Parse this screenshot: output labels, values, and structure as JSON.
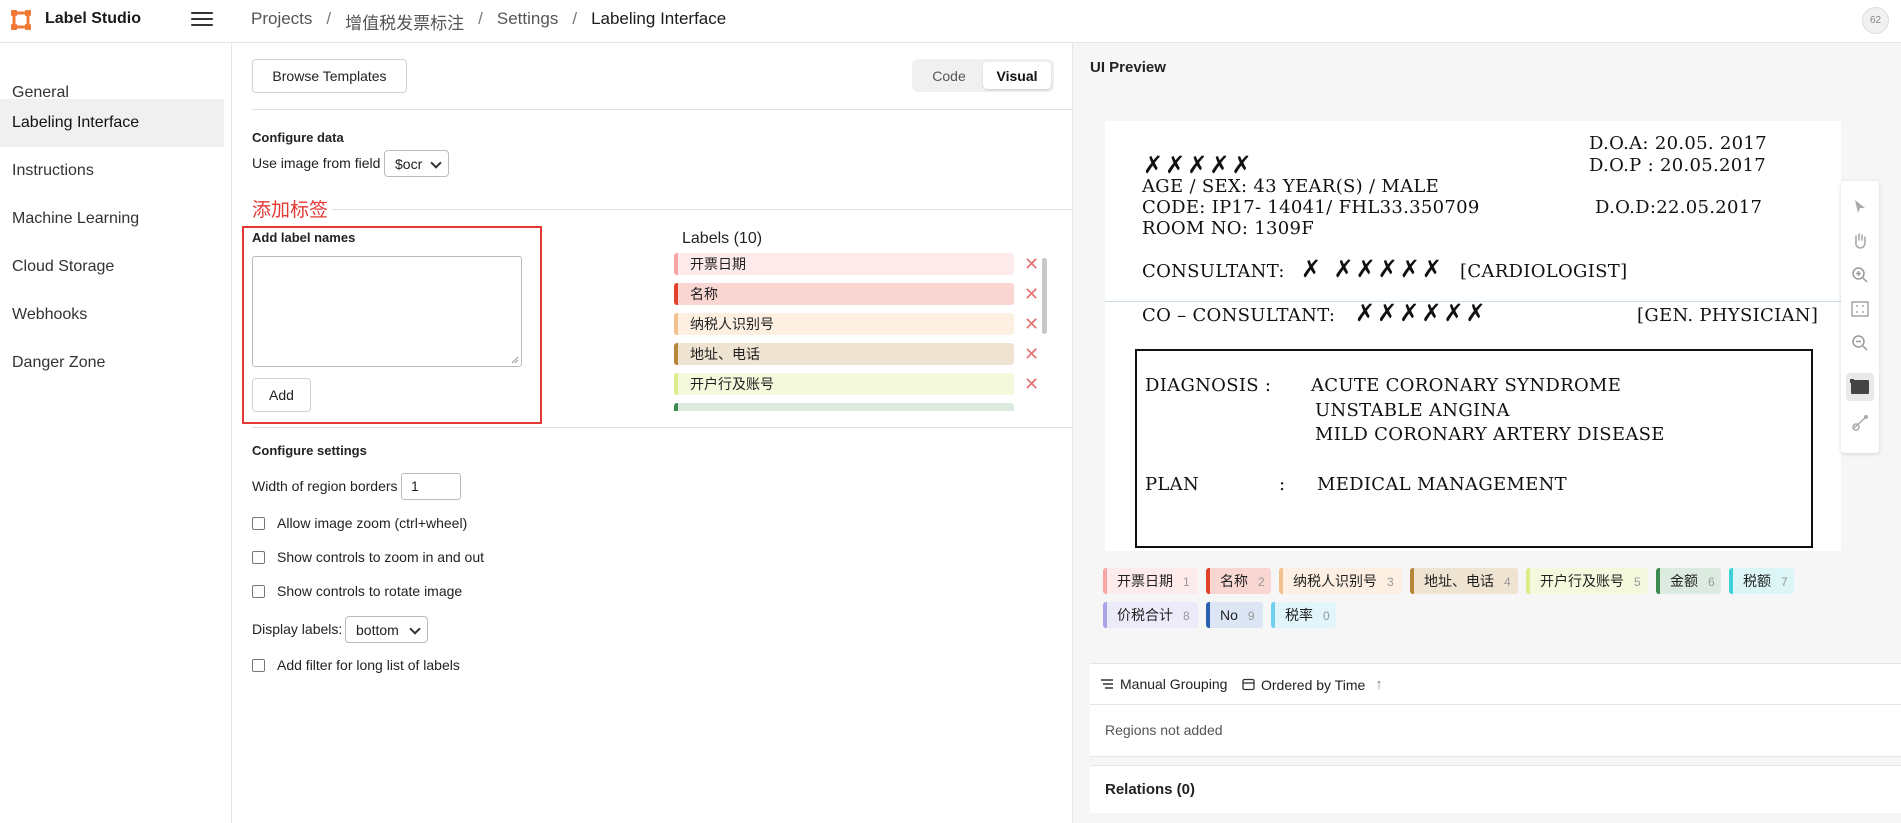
{
  "app": {
    "title": "Label Studio"
  },
  "breadcrumb": [
    "Projects",
    "增值税发票标注",
    "Settings",
    "Labeling Interface"
  ],
  "avatar": "62",
  "sidebar": {
    "items": [
      {
        "label": "General",
        "active": false
      },
      {
        "label": "Labeling Interface",
        "active": true
      },
      {
        "label": "Instructions",
        "active": false
      },
      {
        "label": "Machine Learning",
        "active": false
      },
      {
        "label": "Cloud Storage",
        "active": false
      },
      {
        "label": "Webhooks",
        "active": false
      },
      {
        "label": "Danger Zone",
        "active": false
      }
    ]
  },
  "config": {
    "browse_templates": "Browse Templates",
    "view_toggle": {
      "code": "Code",
      "visual": "Visual",
      "selected": "Visual"
    },
    "configure_data": {
      "title": "Configure data",
      "field_label": "Use image from field",
      "field_value": "$ocr"
    },
    "annotation_note": "添加标签",
    "add_labels": {
      "title": "Add label names",
      "textarea_value": "",
      "add_button": "Add"
    },
    "labels": {
      "title": "Labels (10)",
      "items": [
        {
          "name": "开票日期",
          "color": "#f8a5a5",
          "bg": "#fdeaea"
        },
        {
          "name": "名称",
          "color": "#e0422b",
          "bg": "#f9d6d1"
        },
        {
          "name": "纳税人识别号",
          "color": "#f2c08f",
          "bg": "#fdf0e3"
        },
        {
          "name": "地址、电话",
          "color": "#b8863b",
          "bg": "#efe4d2"
        },
        {
          "name": "开户行及账号",
          "color": "#dcec8a",
          "bg": "#f4f9de"
        }
      ]
    },
    "configure_settings": {
      "title": "Configure settings",
      "region_border_label": "Width of region borders",
      "region_border_value": "1",
      "checkbox_zoom": "Allow image zoom (ctrl+wheel)",
      "checkbox_zoom_controls": "Show controls to zoom in and out",
      "checkbox_rotate": "Show controls to rotate image",
      "display_labels_label": "Display labels:",
      "display_labels_value": "bottom",
      "checkbox_filter": "Add filter for long list of labels"
    }
  },
  "preview": {
    "title": "UI Preview",
    "document": {
      "doa": "D.O.A: 20.05. 2017",
      "dop": "D.O.P : 20.05.2017",
      "dod": "D.O.D:22.05.2017",
      "age_sex": "AGE / SEX: 43 YEAR(S) / MALE",
      "code": "CODE: IP17- 14041/ FHL33.350709",
      "room": "ROOM NO: 1309F",
      "consultant_label": "CONSULTANT:",
      "consultant_role": "[CARDIOLOGIST]",
      "co_consultant_label": "CO – CONSULTANT:",
      "co_consultant_role": "[GEN. PHYSICIAN]",
      "diagnosis_label": "DIAGNOSIS :",
      "diagnosis_1": "ACUTE CORONARY SYNDROME",
      "diagnosis_2": "UNSTABLE ANGINA",
      "diagnosis_3": "MILD CORONARY ARTERY DISEASE",
      "plan_label": "PLAN",
      "plan_colon": ":",
      "plan_value": "MEDICAL MANAGEMENT"
    },
    "tags": [
      {
        "name": "开票日期",
        "key": "1",
        "color": "#f8a5a5",
        "bg": "#fdeaea"
      },
      {
        "name": "名称",
        "key": "2",
        "color": "#e0422b",
        "bg": "#f9d6d1"
      },
      {
        "name": "纳税人识别号",
        "key": "3",
        "color": "#f2c08f",
        "bg": "#fdf0e3"
      },
      {
        "name": "地址、电话",
        "key": "4",
        "color": "#b8863b",
        "bg": "#efe4d2"
      },
      {
        "name": "开户行及账号",
        "key": "5",
        "color": "#dcec8a",
        "bg": "#f4f9de"
      },
      {
        "name": "金额",
        "key": "6",
        "color": "#3c8a4f",
        "bg": "#dcebdf"
      },
      {
        "name": "税额",
        "key": "7",
        "color": "#3ed0d6",
        "bg": "#dcf6f7"
      },
      {
        "name": "价税合计",
        "key": "8",
        "color": "#a9a4e8",
        "bg": "#ecebfa"
      },
      {
        "name": "No",
        "key": "9",
        "color": "#2c5fb0",
        "bg": "#dce5f3"
      },
      {
        "name": "税率",
        "key": "0",
        "color": "#6dd1ee",
        "bg": "#e1f5fb"
      }
    ],
    "grouping": "Manual Grouping",
    "ordering": "Ordered by Time",
    "regions_empty": "Regions not added",
    "relations": "Relations (0)"
  }
}
